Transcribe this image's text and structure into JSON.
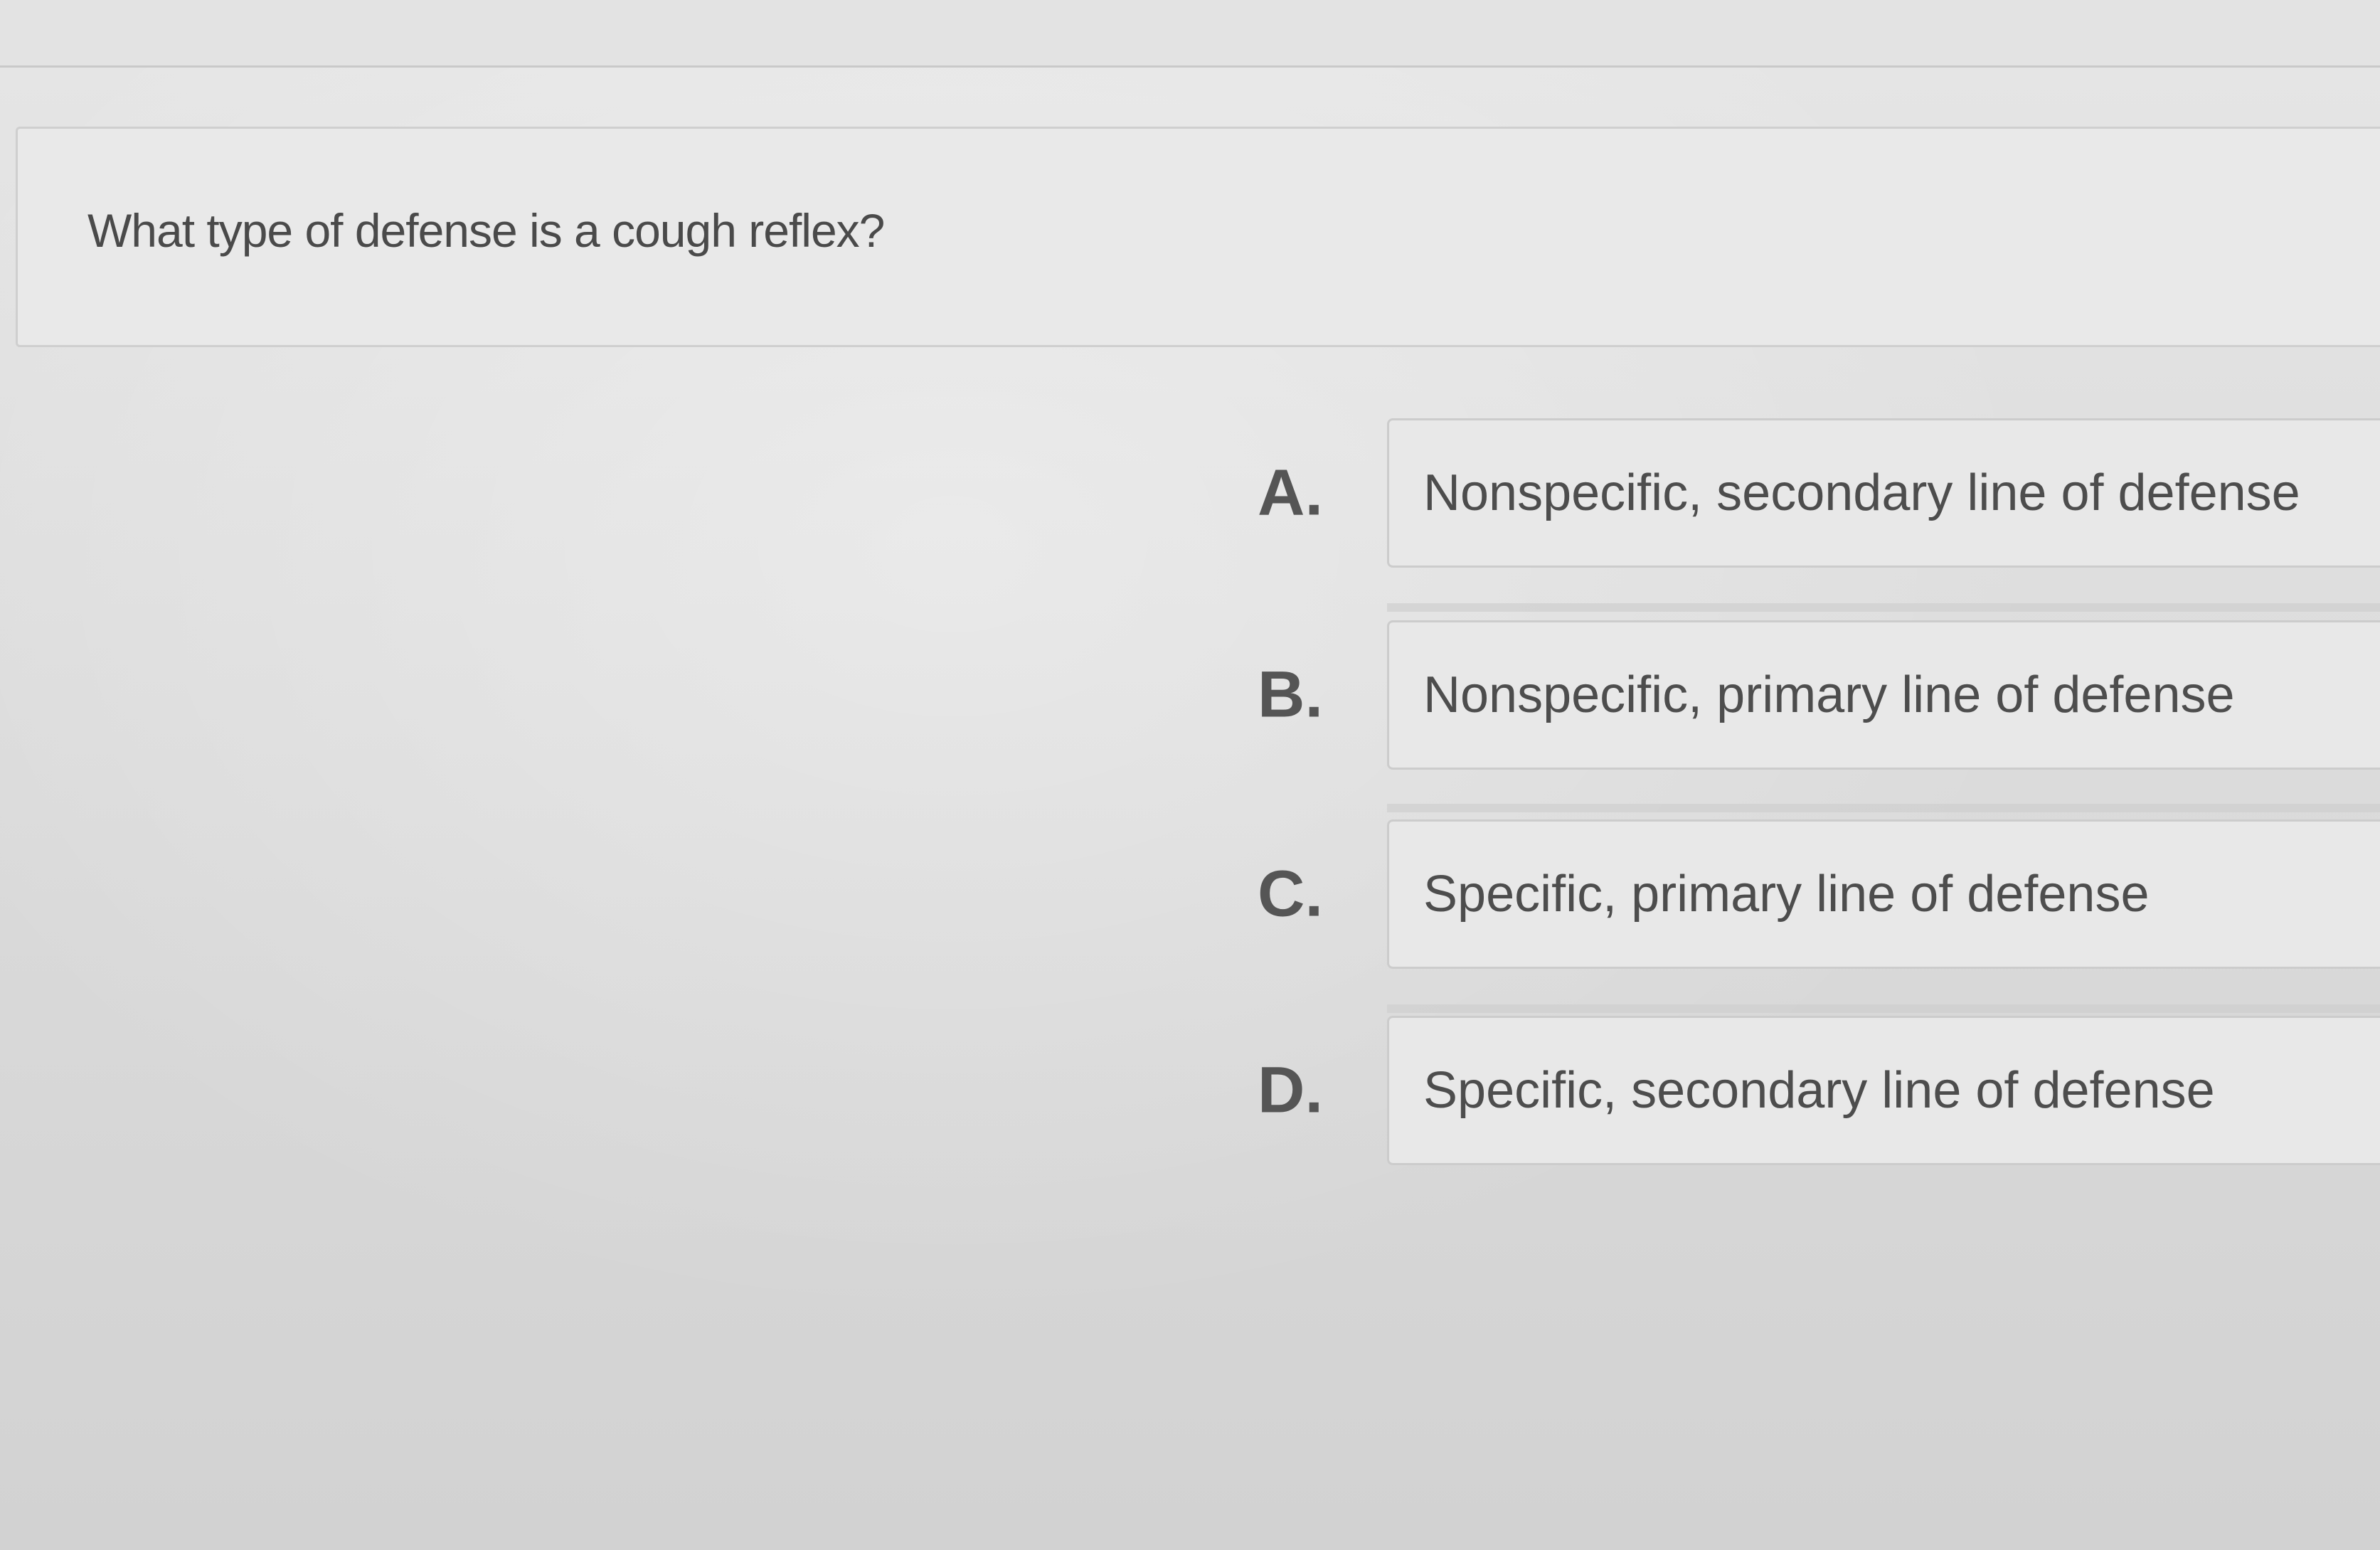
{
  "question": {
    "text": "What type of defense is a cough reflex?"
  },
  "options": [
    {
      "letter": "A.",
      "text": "Nonspecific, secondary line of defense"
    },
    {
      "letter": "B.",
      "text": "Nonspecific, primary line of defense"
    },
    {
      "letter": "C.",
      "text": "Specific, primary line of defense"
    },
    {
      "letter": "D.",
      "text": "Specific, secondary line of defense"
    }
  ]
}
